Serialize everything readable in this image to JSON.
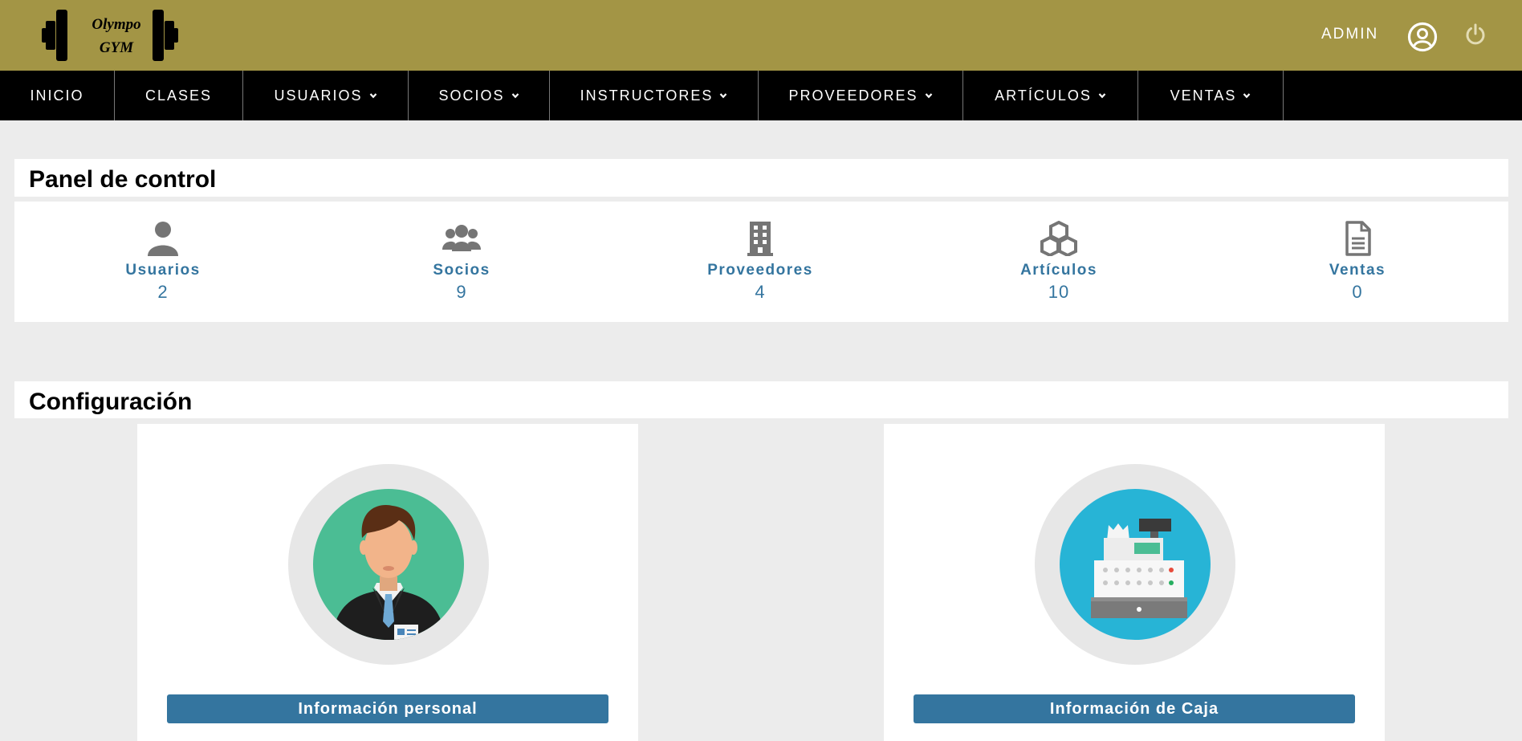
{
  "brand": {
    "line1": "Olympo",
    "line2": "GYM"
  },
  "header": {
    "admin_label": "ADMIN",
    "user_icon": "user-circle-icon",
    "power_icon": "power-icon"
  },
  "nav": [
    {
      "label": "INICIO",
      "dropdown": false
    },
    {
      "label": "CLASES",
      "dropdown": false
    },
    {
      "label": "USUARIOS",
      "dropdown": true
    },
    {
      "label": "SOCIOS",
      "dropdown": true
    },
    {
      "label": "INSTRUCTORES",
      "dropdown": true
    },
    {
      "label": "PROVEEDORES",
      "dropdown": true
    },
    {
      "label": "ARTÍCULOS",
      "dropdown": true
    },
    {
      "label": "VENTAS",
      "dropdown": true
    }
  ],
  "panel": {
    "title": "Panel de control",
    "stats": [
      {
        "label": "Usuarios",
        "value": "2",
        "icon": "user-icon"
      },
      {
        "label": "Socios",
        "value": "9",
        "icon": "users-group-icon"
      },
      {
        "label": "Proveedores",
        "value": "4",
        "icon": "building-icon"
      },
      {
        "label": "Artículos",
        "value": "10",
        "icon": "boxes-icon"
      },
      {
        "label": "Ventas",
        "value": "0",
        "icon": "document-icon"
      }
    ]
  },
  "config": {
    "title": "Configuración",
    "cards": [
      {
        "button": "Información personal",
        "icon": "businessman-avatar-icon"
      },
      {
        "button": "Información de Caja",
        "icon": "cash-register-icon"
      }
    ]
  },
  "colors": {
    "header": "#a39545",
    "nav": "#000000",
    "accent": "#34759f",
    "background": "#ececec"
  }
}
